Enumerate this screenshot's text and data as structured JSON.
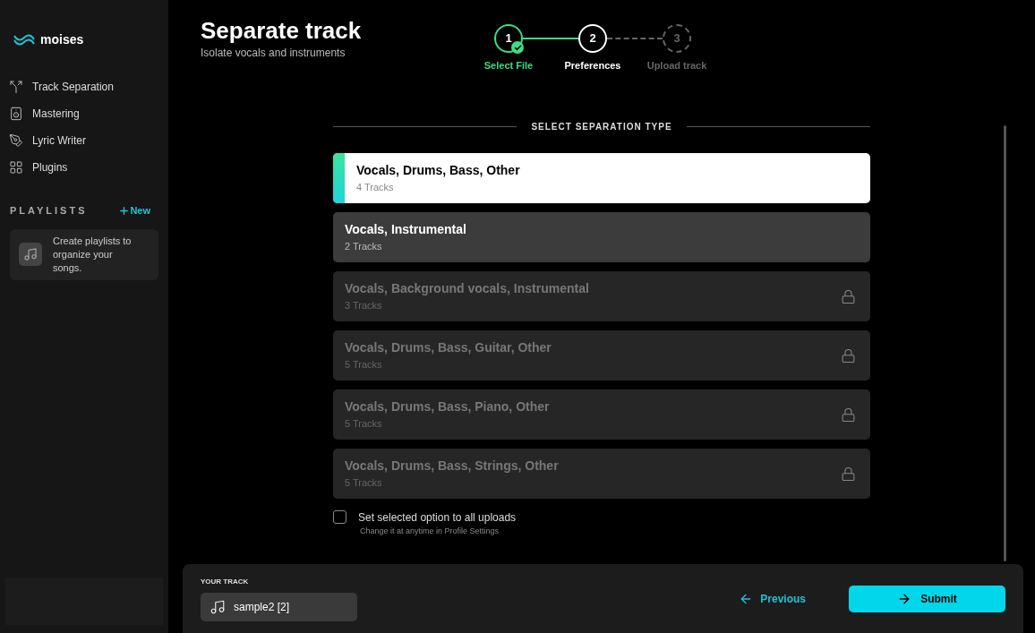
{
  "sidebar": {
    "logo": "moises",
    "nav": [
      {
        "label": "Track Separation"
      },
      {
        "label": "Mastering"
      },
      {
        "label": "Lyric Writer"
      },
      {
        "label": "Plugins"
      }
    ],
    "playlists": {
      "heading": "PLAYLISTS",
      "new_label": "New",
      "empty_message": "Create playlists to organize your songs."
    }
  },
  "header": {
    "title": "Separate track",
    "subtitle": "Isolate vocals and instruments"
  },
  "steps": [
    {
      "number": "1",
      "label": "Select File",
      "done": true,
      "selected": false
    },
    {
      "number": "2",
      "label": "Preferences",
      "done": false,
      "selected": true
    },
    {
      "number": "3",
      "label": "Upload track",
      "done": false,
      "selected": false
    }
  ],
  "section_heading": "SELECT SEPARATION TYPE",
  "options": [
    {
      "title": "Vocals, Drums, Bass, Other",
      "tracks": "4 Tracks",
      "selected": true,
      "locked": false
    },
    {
      "title": "Vocals, Instrumental",
      "tracks": "2 Tracks",
      "selected": false,
      "locked": false
    },
    {
      "title": "Vocals, Background vocals, Instrumental",
      "tracks": "3 Tracks",
      "selected": false,
      "locked": true
    },
    {
      "title": "Vocals, Drums, Bass, Guitar, Other",
      "tracks": "5 Tracks",
      "selected": false,
      "locked": true
    },
    {
      "title": "Vocals, Drums, Bass, Piano, Other",
      "tracks": "5 Tracks",
      "selected": false,
      "locked": true
    },
    {
      "title": "Vocals, Drums, Bass, Strings, Other",
      "tracks": "5 Tracks",
      "selected": false,
      "locked": true
    }
  ],
  "apply_all": {
    "label": "Set selected option to all uploads",
    "hint": "Change it at anytime in Profile Settings",
    "checked": false
  },
  "footer": {
    "heading": "YOUR TRACK",
    "file": "sample2 [2]",
    "previous": "Previous",
    "submit": "Submit"
  }
}
